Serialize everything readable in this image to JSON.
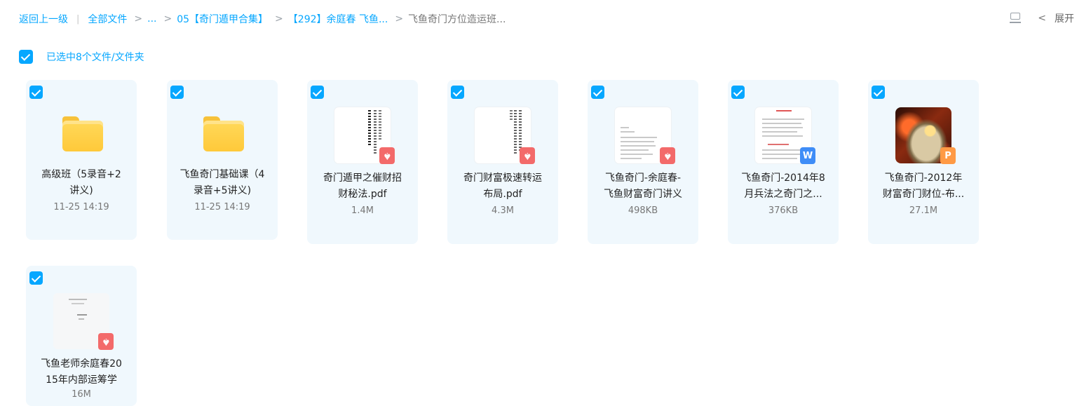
{
  "breadcrumb": {
    "back": "返回上一级",
    "separator": "|",
    "items": [
      "全部文件",
      "...",
      "05【奇门遁甲合集】",
      "【292】余庭春 飞鱼...",
      "飞鱼奇门方位造运班..."
    ]
  },
  "header_right": {
    "expand_label": "展开",
    "list_icon": "list-view-icon",
    "chevron_icon": "chevron-left-icon"
  },
  "selection": {
    "label": "已选中8个文件/文件夹",
    "checked": true
  },
  "files": [
    {
      "type": "folder",
      "name_lines": [
        "高级班（5录音+2",
        "讲义)"
      ],
      "meta": "11-25 14:19"
    },
    {
      "type": "folder",
      "name_lines": [
        "飞鱼奇门基础课（4",
        "录音+5讲义)"
      ],
      "meta": "11-25 14:19"
    },
    {
      "type": "pdf",
      "name_lines": [
        "奇门遁甲之催财招",
        "财秘法.pdf"
      ],
      "meta": "1.4M"
    },
    {
      "type": "pdf",
      "name_lines": [
        "奇门财富极速转运",
        "布局.pdf"
      ],
      "meta": "4.3M"
    },
    {
      "type": "pdf",
      "name_lines": [
        "飞鱼奇门-余庭春-",
        "飞鱼财富奇门讲义"
      ],
      "meta": "498KB"
    },
    {
      "type": "word",
      "badge": "W",
      "name_lines": [
        "飞鱼奇门-2014年8",
        "月兵法之奇门之..."
      ],
      "meta": "376KB"
    },
    {
      "type": "ppt",
      "badge": "P",
      "name_lines": [
        "飞鱼奇门-2012年",
        "财富奇门财位-布..."
      ],
      "meta": "27.1M"
    },
    {
      "type": "pdf",
      "name_lines": [
        "飞鱼老师余庭春20",
        "15年内部运筹学"
      ],
      "meta": "16M"
    }
  ],
  "colors": {
    "accent": "#06a7ff",
    "card_bg": "#f0f8fd",
    "pdf": "#f36a6a",
    "word": "#3f8df7",
    "ppt": "#ff9a45",
    "folder": "#ffc93a"
  }
}
